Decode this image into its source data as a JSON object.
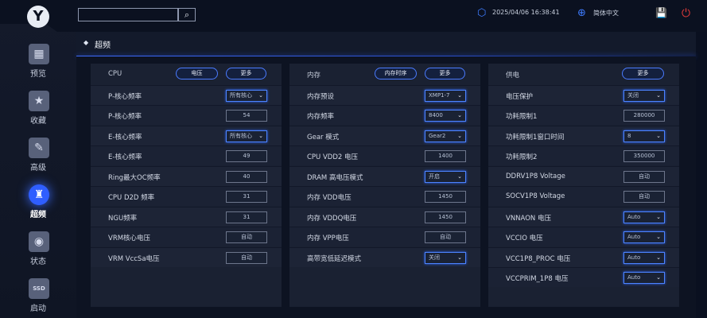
{
  "header": {
    "search_placeholder": "",
    "search_icon": "⌕",
    "datetime": "2025/04/06 16:38:41",
    "language": "简体中文"
  },
  "sidebar": {
    "logo_glyph": "Y",
    "items": [
      {
        "label": "预览",
        "glyph": "▦"
      },
      {
        "label": "收藏",
        "glyph": "★"
      },
      {
        "label": "高级",
        "glyph": "✎"
      },
      {
        "label": "超频",
        "glyph": "♜"
      },
      {
        "label": "状态",
        "glyph": "◉"
      },
      {
        "label": "启动",
        "glyph": "SSD"
      }
    ],
    "active_index": 3
  },
  "page": {
    "title": "超频",
    "title_marker": "◆"
  },
  "panels": [
    {
      "label": "CPU",
      "buttons": [
        "电压",
        "更多"
      ],
      "rows": [
        {
          "label": "P-核心频率",
          "value": "所有核心",
          "type": "select"
        },
        {
          "label": "P-核心频率",
          "value": "54",
          "type": "input"
        },
        {
          "label": "E-核心频率",
          "value": "所有核心",
          "type": "select"
        },
        {
          "label": "E-核心频率",
          "value": "49",
          "type": "input"
        },
        {
          "label": "Ring最大OC频率",
          "value": "40",
          "type": "input"
        },
        {
          "label": "CPU D2D 频率",
          "value": "31",
          "type": "input"
        },
        {
          "label": "NGU频率",
          "value": "31",
          "type": "input"
        },
        {
          "label": "VRM核心电压",
          "value": "自动",
          "type": "input"
        },
        {
          "label": "VRM VccSa电压",
          "value": "自动",
          "type": "input"
        }
      ]
    },
    {
      "label": "内存",
      "buttons": [
        "内存时序",
        "更多"
      ],
      "rows": [
        {
          "label": "内存预设",
          "value": "XMP1-7",
          "type": "select"
        },
        {
          "label": "内存频率",
          "value": "8400",
          "type": "select"
        },
        {
          "label": "Gear 模式",
          "value": "Gear2",
          "type": "select"
        },
        {
          "label": "CPU VDD2 电压",
          "value": "1400",
          "type": "input"
        },
        {
          "label": "DRAM 高电压模式",
          "value": "开启",
          "type": "select"
        },
        {
          "label": "内存 VDD电压",
          "value": "1450",
          "type": "input"
        },
        {
          "label": "内存 VDDQ电压",
          "value": "1450",
          "type": "input"
        },
        {
          "label": "内存 VPP电压",
          "value": "自动",
          "type": "input"
        },
        {
          "label": "高带宽低延迟模式",
          "value": "关闭",
          "type": "select"
        }
      ]
    },
    {
      "label": "供电",
      "buttons": [
        "更多"
      ],
      "rows": [
        {
          "label": "电压保护",
          "value": "关闭",
          "type": "select"
        },
        {
          "label": "功耗限制1",
          "value": "280000",
          "type": "input"
        },
        {
          "label": "功耗限制1窗口时间",
          "value": "8",
          "type": "select"
        },
        {
          "label": "功耗限制2",
          "value": "350000",
          "type": "input"
        },
        {
          "label": "DDRV1P8 Voltage",
          "value": "自动",
          "type": "input"
        },
        {
          "label": "SOCV1P8 Voltage",
          "value": "自动",
          "type": "input"
        },
        {
          "label": "VNNAON 电压",
          "value": "Auto",
          "type": "select"
        },
        {
          "label": "VCCIO 电压",
          "value": "Auto",
          "type": "select"
        },
        {
          "label": "VCC1P8_PROC 电压",
          "value": "Auto",
          "type": "select"
        },
        {
          "label": "VCCPRIM_1P8 电压",
          "value": "Auto",
          "type": "select"
        }
      ]
    }
  ],
  "icons": {
    "gear": "⬡",
    "globe": "⊕",
    "save": "💾",
    "power": "⏻",
    "chevron": "⌄"
  },
  "colors": {
    "accent": "#3e7cff",
    "power": "#e23a3a"
  }
}
